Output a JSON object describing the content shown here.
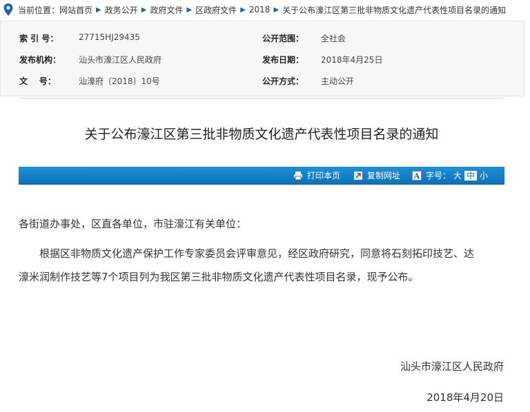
{
  "breadcrumb": {
    "prefix": "当前位置：",
    "items": [
      "网站首页",
      "政务公开",
      "政府文件",
      "区政府文件",
      "2018",
      "关于公布濠江区第三批非物质文化遗产代表性项目名录的通知"
    ]
  },
  "meta": {
    "index_label": "索 引 号：",
    "index_value": "27715HJ29435",
    "scope_label": "公开范围：",
    "scope_value": "全社会",
    "issuer_label": "发布机构：",
    "issuer_value": "汕头市濠江区人民政府",
    "date_label": "发布日期：",
    "date_value": "2018年4月25日",
    "docno_label": "文    号：",
    "docno_value": "汕濠府〔2018〕10号",
    "method_label": "公开方式：",
    "method_value": "主动公开"
  },
  "article": {
    "title": "关于公布濠江区第三批非物质文化遗产代表性项目名录的通知",
    "salutation": "各街道办事处，区直各单位，市驻濠江有关单位：",
    "body_line1": "根据区非物质文化遗产保护工作专家委员会评审意见，经区政府研究，同意将石刻拓印技艺、达",
    "body_line2": "濠米润制作技艺等7个项目列为我区第三批非物质文化遗产代表性项目名录，现予公布。",
    "signature": "汕头市濠江区人民政府",
    "sign_date": "2018年4月20日"
  },
  "toolbar": {
    "print": "打印本页",
    "copy": "复制网址",
    "font_label": "字号：",
    "font_large": "大",
    "font_medium": "中",
    "font_small": "小"
  },
  "icons": {
    "location": "location-pin-icon",
    "print": "printer-icon",
    "copy": "copy-link-icon",
    "font": "font-size-icon"
  },
  "colors": {
    "accent": "#0e72b8",
    "pin": "#1a64b4"
  }
}
